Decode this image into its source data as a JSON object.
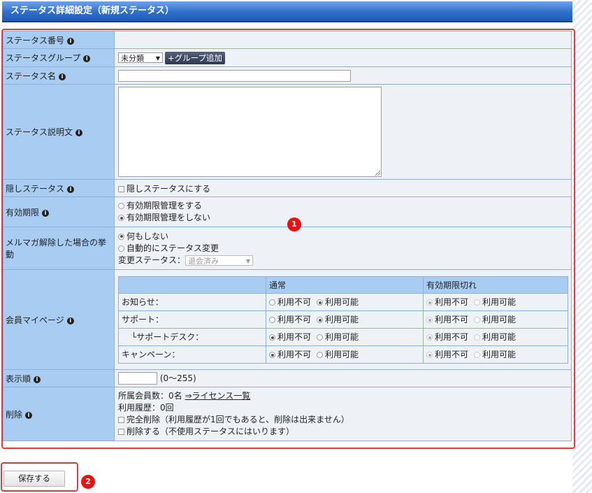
{
  "header": {
    "title": "ステータス詳細設定（新規ステータス）"
  },
  "info_glyph": "i",
  "rows": {
    "status_no": {
      "label": "ステータス番号"
    },
    "status_group": {
      "label": "ステータスグループ",
      "select_value": "未分類",
      "add_button": "+グループ追加"
    },
    "status_name": {
      "label": "ステータス名"
    },
    "status_desc": {
      "label": "ステータス説明文"
    },
    "hidden": {
      "label": "隠しステータス",
      "checkbox_label": "隠しステータスにする"
    },
    "expiry": {
      "label": "有効期限",
      "options": [
        "有効期限管理をする",
        "有効期限管理をしない"
      ]
    },
    "unsubscribe": {
      "label": "メルマガ解除した場合の挙動",
      "options": [
        "何もしない",
        "自動的にステータス変更"
      ],
      "change_label": "変更ステータス：",
      "change_value": "退会済み"
    },
    "mypage": {
      "label": "会員マイページ",
      "col_normal": "通常",
      "col_expired": "有効期限切れ",
      "items": [
        {
          "name": "お知らせ："
        },
        {
          "name": "サポート："
        },
        {
          "name": "└サポートデスク："
        },
        {
          "name": "キャンペーン："
        }
      ],
      "opt_off": "利用不可",
      "opt_on": "利用可能"
    },
    "order": {
      "label": "表示順",
      "range": "(0～255)"
    },
    "delete": {
      "label": "削除",
      "members": "所属会員数：0名",
      "license_link": "⇒ライセンス一覧",
      "history": "利用履歴：0回",
      "full_delete": "完全削除（利用履歴が1回でもあると、削除は出来ません）",
      "delete_unused": "削除する（不使用ステータスにはいります）"
    }
  },
  "save_button": "保存する",
  "badges": {
    "one": "1",
    "two": "2"
  }
}
